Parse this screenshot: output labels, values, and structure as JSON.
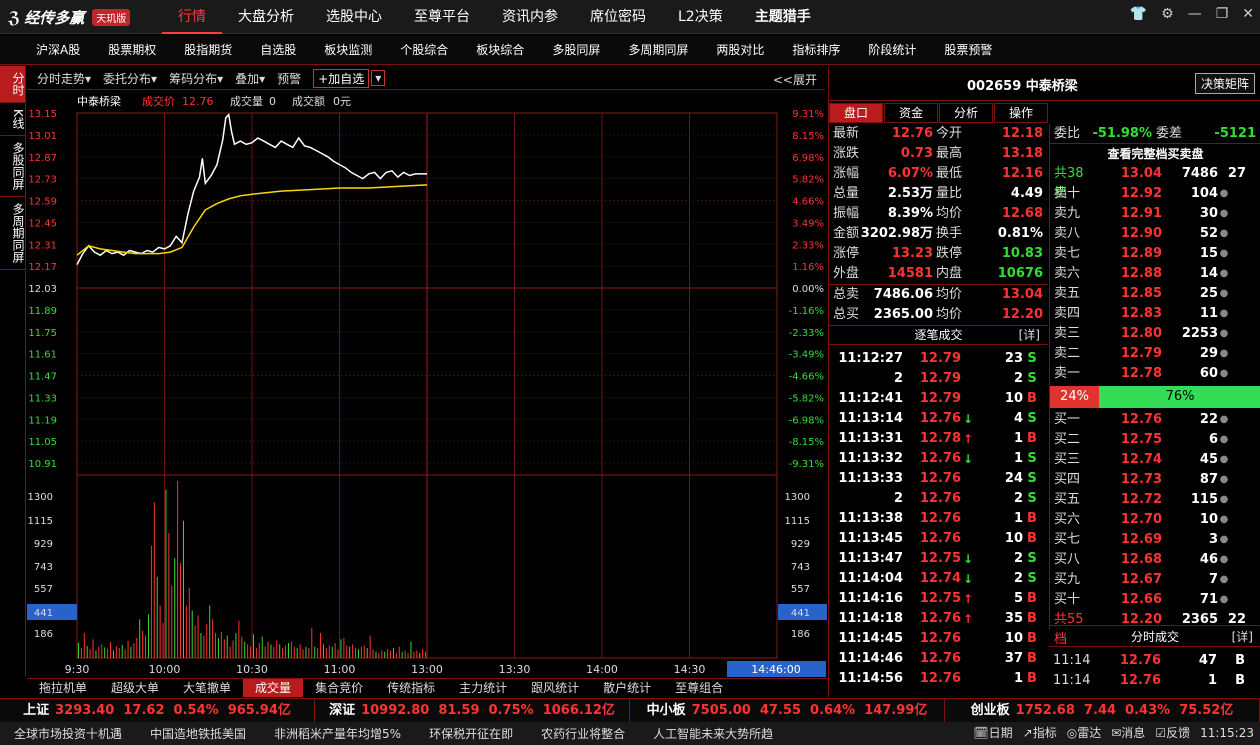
{
  "app": {
    "logo_text": "经传多赢",
    "edition": "天玑版"
  },
  "main_nav": [
    {
      "label": "行情",
      "active": true
    },
    {
      "label": "大盘分析"
    },
    {
      "label": "选股中心"
    },
    {
      "label": "至尊平台"
    },
    {
      "label": "资讯内参"
    },
    {
      "label": "席位密码"
    },
    {
      "label": "L2决策"
    },
    {
      "label": "主题猎手",
      "bold": true
    }
  ],
  "sub_nav": [
    "沪深A股",
    "股票期权",
    "股指期货",
    "自选股",
    "板块监测",
    "个股综合",
    "板块综合",
    "多股同屏",
    "多周期同屏",
    "两股对比",
    "指标排序",
    "阶段统计",
    "股票预警"
  ],
  "left_tabs": [
    {
      "label": "分时",
      "active": true
    },
    {
      "label": "K线"
    },
    {
      "label": "多股同屏"
    },
    {
      "label": "多周期同屏"
    }
  ],
  "chart_toolbar": {
    "items": [
      "分时走势▾",
      "委托分布▾",
      "筹码分布▾",
      "叠加▾",
      "预警"
    ],
    "add_watch": "+加自选",
    "expand": "<<展开"
  },
  "chart_info": {
    "name": "中泰桥梁",
    "price_label": "成交价",
    "price": "12.76",
    "vol_label": "成交量",
    "vol": "0",
    "amt_label": "成交额",
    "amt": "0元"
  },
  "chart_data": {
    "type": "line",
    "price_ticks": [
      "13.15",
      "13.01",
      "12.87",
      "12.73",
      "12.59",
      "12.45",
      "12.31",
      "12.17",
      "12.03",
      "11.89",
      "11.75",
      "11.61",
      "11.47",
      "11.33",
      "11.19",
      "11.05",
      "10.91"
    ],
    "pct_ticks": [
      "9.31%",
      "8.15%",
      "6.98%",
      "5.82%",
      "4.66%",
      "3.49%",
      "2.33%",
      "1.16%",
      "0.00%",
      "-1.16%",
      "-2.33%",
      "-3.49%",
      "-4.66%",
      "-5.82%",
      "-6.98%",
      "-8.15%",
      "-9.31%"
    ],
    "vol_ticks": [
      "1300",
      "1115",
      "929",
      "743",
      "557",
      "441",
      "186"
    ],
    "vol_current": "441",
    "time_ticks": [
      "9:30",
      "10:00",
      "10:30",
      "11:00",
      "13:00",
      "13:30",
      "14:00",
      "14:30"
    ],
    "time_current": "14:46:00",
    "ylim": [
      10.91,
      13.15
    ],
    "vol_max": 1450,
    "total_minutes": 240,
    "prev_close": 12.03,
    "price_points": [
      [
        0,
        12.18
      ],
      [
        2,
        12.25
      ],
      [
        4,
        12.3
      ],
      [
        6,
        12.26
      ],
      [
        8,
        12.24
      ],
      [
        10,
        12.27
      ],
      [
        12,
        12.25
      ],
      [
        14,
        12.26
      ],
      [
        16,
        12.24
      ],
      [
        18,
        12.27
      ],
      [
        20,
        12.26
      ],
      [
        22,
        12.25
      ],
      [
        24,
        12.27
      ],
      [
        26,
        12.26
      ],
      [
        28,
        12.29
      ],
      [
        30,
        12.28
      ],
      [
        32,
        12.3
      ],
      [
        34,
        12.36
      ],
      [
        36,
        12.32
      ],
      [
        38,
        12.5
      ],
      [
        40,
        12.65
      ],
      [
        42,
        12.74
      ],
      [
        43,
        12.86
      ],
      [
        44,
        12.7
      ],
      [
        46,
        12.75
      ],
      [
        48,
        12.82
      ],
      [
        50,
        12.98
      ],
      [
        51,
        13.12
      ],
      [
        52,
        13.14
      ],
      [
        53,
        13.03
      ],
      [
        54,
        12.95
      ],
      [
        56,
        12.97
      ],
      [
        58,
        12.95
      ],
      [
        60,
        12.96
      ],
      [
        62,
        12.99
      ],
      [
        64,
        12.97
      ],
      [
        66,
        12.95
      ],
      [
        68,
        12.93
      ],
      [
        70,
        12.97
      ],
      [
        72,
        12.95
      ],
      [
        74,
        12.93
      ],
      [
        76,
        12.99
      ],
      [
        78,
        12.94
      ],
      [
        80,
        12.93
      ],
      [
        82,
        12.91
      ],
      [
        84,
        12.89
      ],
      [
        86,
        12.87
      ],
      [
        88,
        12.84
      ],
      [
        90,
        12.82
      ],
      [
        92,
        12.8
      ],
      [
        94,
        12.77
      ],
      [
        96,
        12.75
      ],
      [
        98,
        12.73
      ],
      [
        100,
        12.76
      ],
      [
        102,
        12.77
      ],
      [
        104,
        12.73
      ],
      [
        106,
        12.77
      ],
      [
        108,
        12.78
      ],
      [
        110,
        12.74
      ],
      [
        112,
        12.77
      ],
      [
        114,
        12.75
      ],
      [
        116,
        12.76
      ],
      [
        118,
        12.76
      ],
      [
        120,
        12.76
      ]
    ],
    "avg_points": [
      [
        0,
        12.24
      ],
      [
        4,
        12.3
      ],
      [
        8,
        12.28
      ],
      [
        12,
        12.27
      ],
      [
        16,
        12.26
      ],
      [
        20,
        12.25
      ],
      [
        24,
        12.25
      ],
      [
        28,
        12.25
      ],
      [
        32,
        12.26
      ],
      [
        36,
        12.29
      ],
      [
        40,
        12.42
      ],
      [
        44,
        12.53
      ],
      [
        48,
        12.57
      ],
      [
        52,
        12.6
      ],
      [
        56,
        12.62
      ],
      [
        60,
        12.63
      ],
      [
        70,
        12.65
      ],
      [
        80,
        12.66
      ],
      [
        90,
        12.67
      ],
      [
        100,
        12.67
      ],
      [
        110,
        12.68
      ],
      [
        120,
        12.69
      ]
    ],
    "volumes": [
      120,
      80,
      200,
      95,
      70,
      150,
      60,
      90,
      110,
      85,
      75,
      130,
      60,
      95,
      80,
      105,
      70,
      140,
      90,
      120,
      160,
      310,
      220,
      180,
      350,
      900,
      1250,
      650,
      420,
      280,
      1350,
      1000,
      580,
      800,
      1420,
      760,
      1100,
      420,
      560,
      380,
      260,
      340,
      200,
      180,
      270,
      420,
      310,
      200,
      160,
      210,
      150,
      180,
      90,
      140,
      200,
      300,
      170,
      130,
      110,
      90,
      190,
      80,
      120,
      170,
      90,
      130,
      110,
      90,
      140,
      110,
      80,
      100,
      120,
      130,
      90,
      80,
      110,
      70,
      90,
      80,
      240,
      90,
      80,
      200,
      110,
      80,
      100,
      90,
      120,
      70,
      150,
      160,
      100,
      90,
      110,
      80,
      70,
      90,
      100,
      80,
      180,
      70,
      50,
      40,
      60,
      50,
      70,
      60,
      80,
      40,
      90,
      50,
      60,
      40,
      130,
      50,
      60,
      40,
      70,
      50
    ]
  },
  "bottom_tabs": [
    {
      "label": "拖拉机单"
    },
    {
      "label": "超级大单"
    },
    {
      "label": "大笔撤单"
    },
    {
      "label": "成交量",
      "active": true
    },
    {
      "label": "集合竞价"
    },
    {
      "label": "传统指标"
    },
    {
      "label": "主力统计"
    },
    {
      "label": "跟风统计"
    },
    {
      "label": "散户统计"
    },
    {
      "label": "至尊组合"
    }
  ],
  "stock": {
    "code_name": "002659 中泰桥梁",
    "decision_btn": "决策矩阵"
  },
  "quote_tabs": [
    {
      "label": "盘口",
      "active": true
    },
    {
      "label": "资金"
    },
    {
      "label": "分析"
    },
    {
      "label": "操作"
    }
  ],
  "quote": [
    {
      "l": "最新",
      "v": "12.76",
      "vc": "red",
      "l2": "今开",
      "v2": "12.18",
      "v2c": "red"
    },
    {
      "l": "涨跌",
      "v": "0.73",
      "vc": "red",
      "l2": "最高",
      "v2": "13.18",
      "v2c": "red"
    },
    {
      "l": "涨幅",
      "v": "6.07%",
      "vc": "red",
      "l2": "最低",
      "v2": "12.16",
      "v2c": "red"
    },
    {
      "l": "总量",
      "v": "2.53万",
      "vc": "white",
      "l2": "量比",
      "v2": "4.49",
      "v2c": "white"
    },
    {
      "l": "振幅",
      "v": "8.39%",
      "vc": "white",
      "l2": "均价",
      "v2": "12.68",
      "v2c": "red"
    },
    {
      "l": "金额",
      "v": "3202.98万",
      "vc": "white",
      "l2": "换手",
      "v2": "0.81%",
      "v2c": "white"
    },
    {
      "l": "涨停",
      "v": "13.23",
      "vc": "red",
      "l2": "跌停",
      "v2": "10.83",
      "v2c": "green"
    },
    {
      "l": "外盘",
      "v": "14581",
      "vc": "red",
      "l2": "内盘",
      "v2": "10676",
      "v2c": "green"
    }
  ],
  "zs": [
    {
      "l": "总卖",
      "v": "7486.06",
      "l2": "均价",
      "v2": "13.04"
    },
    {
      "l": "总买",
      "v": "2365.00",
      "l2": "均价",
      "v2": "12.20"
    }
  ],
  "trades_header": {
    "title": "逐笔成交",
    "detail": "[详]"
  },
  "trades": [
    {
      "t": "11:12:27",
      "p": "12.79",
      "ar": "",
      "vol": "23",
      "bs": "S"
    },
    {
      "t": "2",
      "p": "12.79",
      "ar": "",
      "vol": "2",
      "bs": "S"
    },
    {
      "t": "11:12:41",
      "p": "12.79",
      "ar": "",
      "vol": "10",
      "bs": "B"
    },
    {
      "t": "11:13:14",
      "p": "12.76",
      "ar": "↓",
      "vol": "4",
      "bs": "S"
    },
    {
      "t": "11:13:31",
      "p": "12.78",
      "ar": "↑",
      "vol": "1",
      "bs": "B"
    },
    {
      "t": "11:13:32",
      "p": "12.76",
      "ar": "↓",
      "vol": "1",
      "bs": "S"
    },
    {
      "t": "11:13:33",
      "p": "12.76",
      "ar": "",
      "vol": "24",
      "bs": "S"
    },
    {
      "t": "2",
      "p": "12.76",
      "ar": "",
      "vol": "2",
      "bs": "S"
    },
    {
      "t": "11:13:38",
      "p": "12.76",
      "ar": "",
      "vol": "1",
      "bs": "B"
    },
    {
      "t": "11:13:45",
      "p": "12.76",
      "ar": "",
      "vol": "10",
      "bs": "B"
    },
    {
      "t": "11:13:47",
      "p": "12.75",
      "ar": "↓",
      "vol": "2",
      "bs": "S"
    },
    {
      "t": "11:14:04",
      "p": "12.74",
      "ar": "↓",
      "vol": "2",
      "bs": "S"
    },
    {
      "t": "11:14:16",
      "p": "12.75",
      "ar": "↑",
      "vol": "5",
      "bs": "B"
    },
    {
      "t": "11:14:18",
      "p": "12.76",
      "ar": "↑",
      "vol": "35",
      "bs": "B"
    },
    {
      "t": "11:14:45",
      "p": "12.76",
      "ar": "",
      "vol": "10",
      "bs": "B"
    },
    {
      "t": "11:14:46",
      "p": "12.76",
      "ar": "",
      "vol": "37",
      "bs": "B"
    },
    {
      "t": "11:14:56",
      "p": "12.76",
      "ar": "",
      "vol": "1",
      "bs": "B"
    }
  ],
  "order_book": {
    "wb_label": "委比",
    "wb": "-51.98%",
    "wc_label": "委差",
    "wc": "-5121",
    "full_link": "查看完整档买卖盘",
    "sell_total": {
      "n": "共38档",
      "p": "13.04",
      "vol": "7486",
      "x": "27"
    },
    "sells": [
      {
        "n": "卖十",
        "p": "12.92",
        "vol": "104"
      },
      {
        "n": "卖九",
        "p": "12.91",
        "vol": "30"
      },
      {
        "n": "卖八",
        "p": "12.90",
        "vol": "52"
      },
      {
        "n": "卖七",
        "p": "12.89",
        "vol": "15"
      },
      {
        "n": "卖六",
        "p": "12.88",
        "vol": "14"
      },
      {
        "n": "卖五",
        "p": "12.85",
        "vol": "25"
      },
      {
        "n": "卖四",
        "p": "12.83",
        "vol": "11"
      },
      {
        "n": "卖三",
        "p": "12.80",
        "vol": "2253",
        "hl": true
      },
      {
        "n": "卖二",
        "p": "12.79",
        "vol": "29"
      },
      {
        "n": "卖一",
        "p": "12.78",
        "vol": "60"
      }
    ],
    "ratio_sell": "24%",
    "ratio_buy": "76%",
    "buys": [
      {
        "n": "买一",
        "p": "12.76",
        "vol": "22"
      },
      {
        "n": "买二",
        "p": "12.75",
        "vol": "6"
      },
      {
        "n": "买三",
        "p": "12.74",
        "vol": "45"
      },
      {
        "n": "买四",
        "p": "12.73",
        "vol": "87"
      },
      {
        "n": "买五",
        "p": "12.72",
        "vol": "115"
      },
      {
        "n": "买六",
        "p": "12.70",
        "vol": "10"
      },
      {
        "n": "买七",
        "p": "12.69",
        "vol": "3"
      },
      {
        "n": "买八",
        "p": "12.68",
        "vol": "46"
      },
      {
        "n": "买九",
        "p": "12.67",
        "vol": "7"
      },
      {
        "n": "买十",
        "p": "12.66",
        "vol": "71"
      }
    ],
    "buy_total": {
      "n": "共55档",
      "p": "12.20",
      "vol": "2365",
      "x": "22"
    }
  },
  "fs_header": {
    "title": "分时成交",
    "detail": "[详]"
  },
  "fs": [
    {
      "t": "11:14",
      "p": "12.76",
      "vol": "47",
      "bs": "B"
    },
    {
      "t": "11:14",
      "p": "12.76",
      "vol": "1",
      "bs": "B"
    }
  ],
  "indices": [
    {
      "name": "上证",
      "text": "3293.40  17.62  0.54%  965.94亿"
    },
    {
      "name": "深证",
      "text": "10992.80  81.59  0.75%  1066.12亿"
    },
    {
      "name": "中小板",
      "text": "7505.00  47.55  0.64%  147.99亿"
    },
    {
      "name": "创业板",
      "text": "1752.68  7.44  0.43%  75.52亿"
    }
  ],
  "news": [
    "全球市场投资十机遇",
    "中国造地铁抵美国",
    "非洲稻米产量年均增5%",
    "环保税开征在即",
    "农药行业将整合",
    "人工智能未来大势所趋"
  ],
  "status": {
    "date": "日期",
    "indicator": "指标",
    "radar": "雷达",
    "msg": "消息",
    "feedback": "反馈",
    "time": "11:15:23"
  },
  "colors": {
    "red": "#ff3333",
    "green": "#33dd33",
    "yellow": "#ffd700",
    "accent": "#b81c1c"
  }
}
